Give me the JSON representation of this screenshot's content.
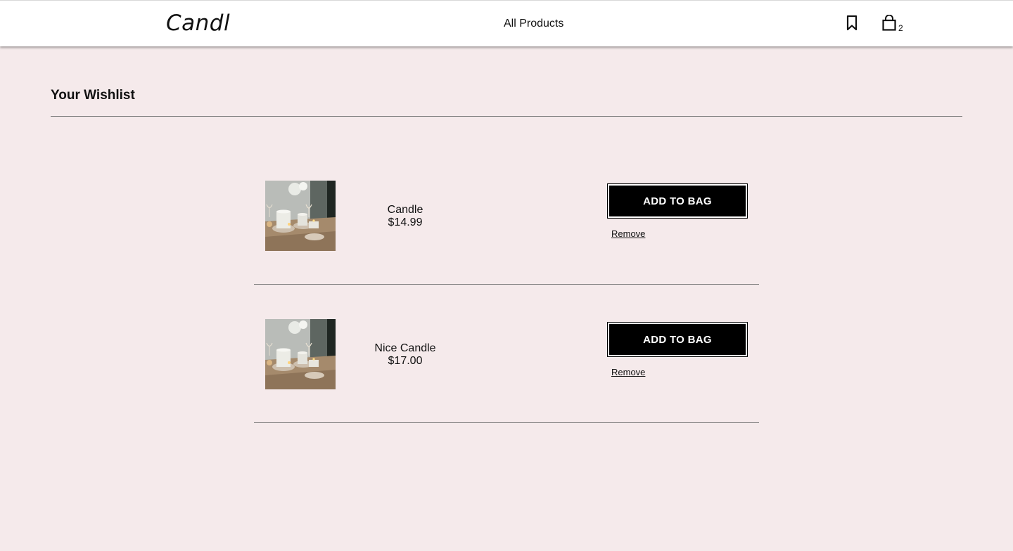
{
  "header": {
    "logo": "Candl",
    "nav_link": "All Products",
    "wishlist_icon": "bookmark-icon",
    "bag_icon": "shopping-bag-icon",
    "bag_count": "2"
  },
  "main": {
    "title": "Your Wishlist",
    "items": [
      {
        "name": "Candle",
        "price": "$14.99",
        "add_label": "ADD TO BAG",
        "remove_label": "Remove"
      },
      {
        "name": "Nice Candle",
        "price": "$17.00",
        "add_label": "ADD TO BAG",
        "remove_label": "Remove"
      }
    ]
  },
  "colors": {
    "page_background": "#f5eaeb",
    "header_background": "#ffffff",
    "button_background": "#000000",
    "button_text": "#ffffff"
  }
}
